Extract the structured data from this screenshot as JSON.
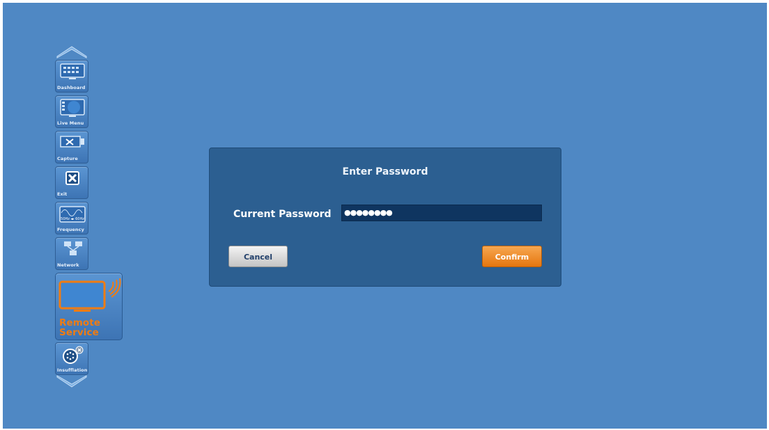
{
  "sidebar": {
    "items": [
      {
        "label": "Dashboard",
        "icon": "dashboard-icon"
      },
      {
        "label": "Live Menu",
        "icon": "live-menu-icon"
      },
      {
        "label": "Capture",
        "icon": "capture-icon"
      },
      {
        "label": "Exit",
        "icon": "exit-icon"
      },
      {
        "label": "Frequency",
        "icon": "frequency-icon",
        "icon_text": "50Hz ◂▸ 60Hz"
      },
      {
        "label": "Network",
        "icon": "network-icon"
      },
      {
        "label": "Remote Service",
        "icon": "remote-service-icon",
        "selected": true
      },
      {
        "label": "Insufflation",
        "icon": "insufflation-icon"
      }
    ]
  },
  "dialog": {
    "title": "Enter Password",
    "field_label": "Current Password",
    "password_mask": "●●●●●●●●",
    "cancel_label": "Cancel",
    "confirm_label": "Confirm"
  },
  "colors": {
    "background": "#4f88c4",
    "dialog": "#2c5f91",
    "field": "#0f3560",
    "accent": "#f07c12"
  }
}
